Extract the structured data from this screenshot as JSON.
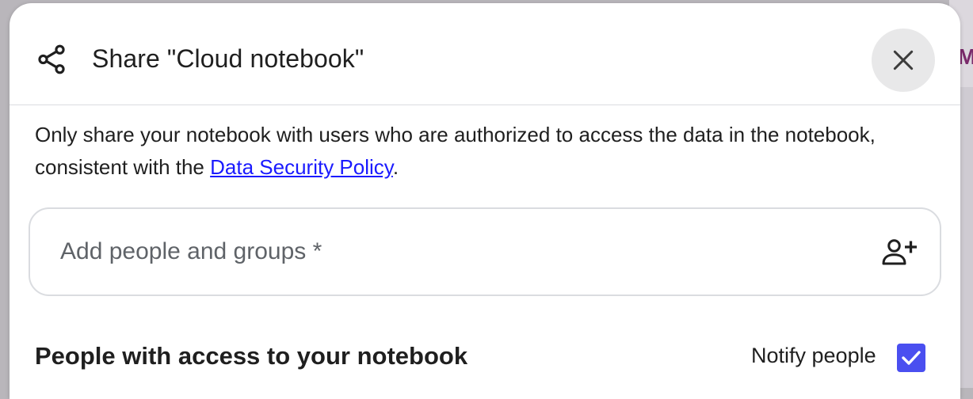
{
  "dialog": {
    "title": "Share \"Cloud notebook\"",
    "description_text": "Only share your notebook with users who are authorized to access the data in the notebook, consistent with the ",
    "description_link": "Data Security Policy",
    "description_end": ".",
    "people_input": {
      "value": "",
      "placeholder": "Add people and groups *"
    },
    "section_heading": "People with access to your notebook",
    "notify_label": "Notify people",
    "notify_checked": true
  },
  "background": {
    "edge_letter": "M"
  },
  "icons": {
    "share": "share-icon",
    "close": "close-icon",
    "add_person": "person-add-icon",
    "checkmark": "checkmark-icon"
  },
  "colors": {
    "link": "#1a1aff",
    "checkbox": "#4a4ff0",
    "close_button_bg": "#e8e8e9"
  }
}
